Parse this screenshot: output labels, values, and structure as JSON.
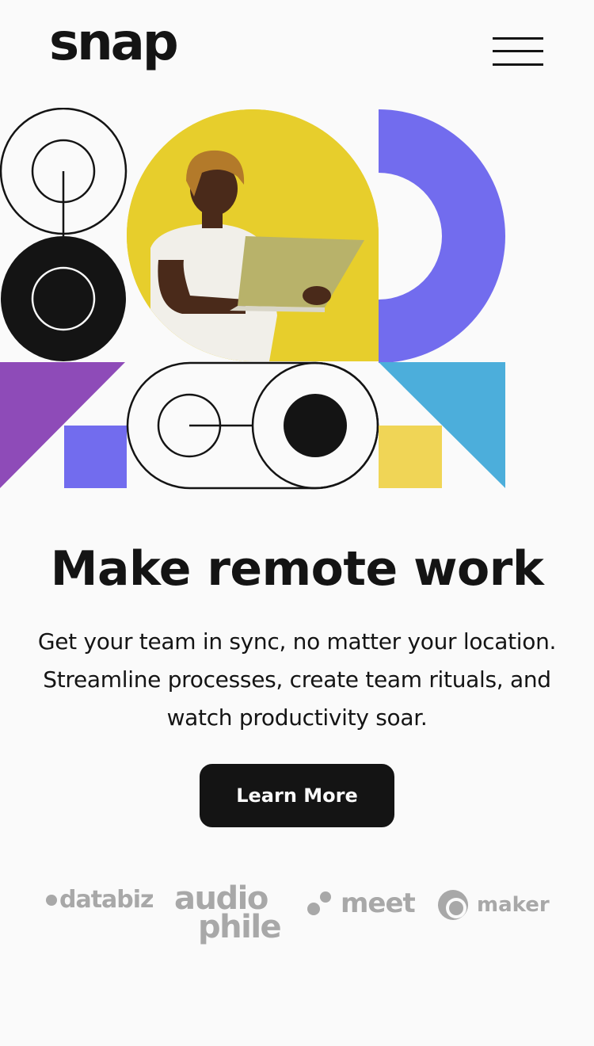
{
  "header": {
    "logo": "snap",
    "menu_icon": "hamburger-menu-icon"
  },
  "hero": {
    "title": "Make remote work",
    "description": "Get your team in sync, no matter your location. Streamline processes, create team rituals, and watch productivity soar.",
    "cta_label": "Learn More"
  },
  "clients": {
    "databiz": "databiz",
    "audiophile_line1": "audio",
    "audiophile_line2": "phile",
    "meet": "meet",
    "maker": "maker"
  },
  "colors": {
    "text": "#141414",
    "background": "#fafafa",
    "yellow": "#e7ce2c",
    "violet": "#726cee",
    "purple": "#8e4bb8",
    "sky": "#4caedb",
    "light_yellow": "#f0d556",
    "client_grey": "#a8a8a8"
  }
}
